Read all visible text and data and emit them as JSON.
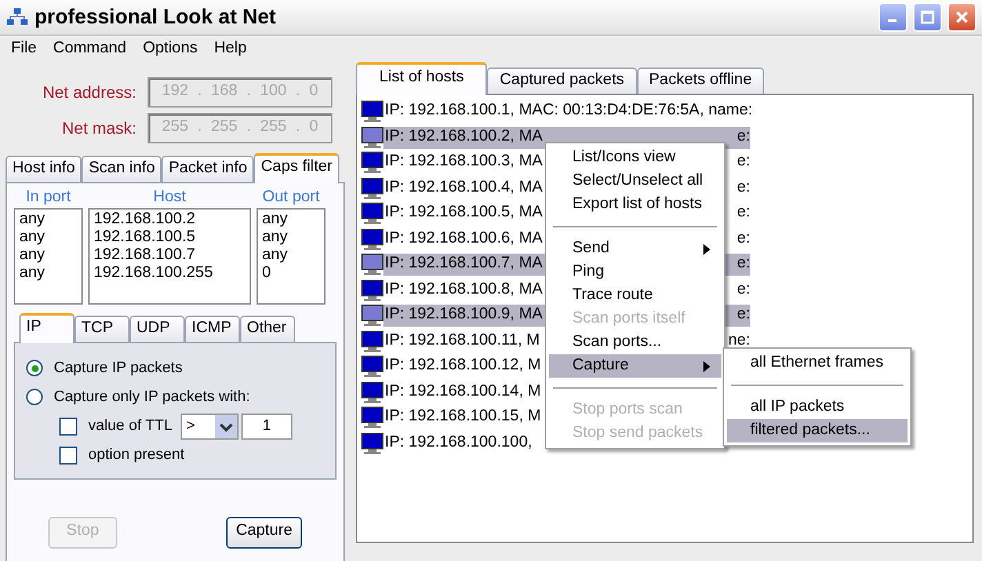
{
  "window": {
    "title": "professional Look at Net"
  },
  "menu_bar": [
    "File",
    "Command",
    "Options",
    "Help"
  ],
  "net": {
    "separator": ".",
    "address_label": "Net address:",
    "address": [
      "192",
      "168",
      "100",
      "0"
    ],
    "mask_label": "Net mask:",
    "mask": [
      "255",
      "255",
      "255",
      "0"
    ]
  },
  "left_tabs": [
    {
      "label": "Host info",
      "selected": false
    },
    {
      "label": "Scan info",
      "selected": false
    },
    {
      "label": "Packet info",
      "selected": false
    },
    {
      "label": "Caps filter",
      "selected": true
    }
  ],
  "filter": {
    "columns": [
      "In port",
      "Host",
      "Out port"
    ],
    "in_ports": [
      "any",
      "any",
      "any",
      "any"
    ],
    "hosts": [
      "192.168.100.2",
      "192.168.100.5",
      "192.168.100.7",
      "192.168.100.255"
    ],
    "out_ports": [
      "any",
      "any",
      "any",
      "0"
    ]
  },
  "protocol_tabs": [
    {
      "label": "IP",
      "selected": true
    },
    {
      "label": "TCP",
      "selected": false
    },
    {
      "label": "UDP",
      "selected": false
    },
    {
      "label": "ICMP",
      "selected": false
    },
    {
      "label": "Other",
      "selected": false
    }
  ],
  "ip_options": {
    "radios": [
      {
        "label": "Capture IP packets",
        "selected": true
      },
      {
        "label": "Capture only IP packets with:",
        "selected": false
      }
    ],
    "checks": [
      {
        "kind": "compare",
        "label": "value of TTL",
        "checked": false,
        "operator": ">",
        "value": "1"
      },
      {
        "kind": "plain",
        "label": "option present",
        "checked": false
      }
    ]
  },
  "buttons": [
    {
      "label": "Stop",
      "disabled": true
    },
    {
      "label": "Capture",
      "disabled": false
    }
  ],
  "right_tabs": [
    {
      "label": "List of hosts",
      "selected": true
    },
    {
      "label": "Captured packets",
      "selected": false
    },
    {
      "label": "Packets offline",
      "selected": false
    }
  ],
  "hosts": [
    {
      "text": "IP: 192.168.100.1, MAC: 00:13:D4:DE:76:5A, name:",
      "selected": false
    },
    {
      "text": "IP: 192.168.100.2, MA",
      "tail": "e:",
      "selected": true
    },
    {
      "text": "IP: 192.168.100.3, MA",
      "tail": "e:",
      "selected": false
    },
    {
      "text": "IP: 192.168.100.4, MA",
      "tail": "e:",
      "selected": false
    },
    {
      "text": "IP: 192.168.100.5, MA",
      "tail": "e:",
      "selected": false
    },
    {
      "text": "IP: 192.168.100.6, MA",
      "tail": "e:",
      "selected": false
    },
    {
      "text": "IP: 192.168.100.7, MA",
      "tail": "e:",
      "selected": true
    },
    {
      "text": "IP: 192.168.100.8, MA",
      "tail": "e:",
      "selected": false
    },
    {
      "text": "IP: 192.168.100.9, MA",
      "tail": "e:",
      "selected": true
    },
    {
      "text": "IP: 192.168.100.11, M",
      "tail": "ne:",
      "selected": false
    },
    {
      "text": "IP: 192.168.100.12, M",
      "selected": false
    },
    {
      "text": "IP: 192.168.100.14, M",
      "selected": false
    },
    {
      "text": "IP: 192.168.100.15, M",
      "selected": false
    },
    {
      "text": "IP: 192.168.100.100,",
      "selected": false
    }
  ],
  "context_menu": [
    {
      "kind": "item",
      "label": "List/Icons view",
      "disabled": false,
      "selected": false
    },
    {
      "kind": "item",
      "label": "Select/Unselect all",
      "disabled": false,
      "selected": false
    },
    {
      "kind": "item",
      "label": "Export list of hosts",
      "disabled": false,
      "selected": false
    },
    {
      "kind": "separator"
    },
    {
      "kind": "submenu",
      "label": "Send",
      "disabled": false,
      "selected": false
    },
    {
      "kind": "item",
      "label": "Ping",
      "disabled": false,
      "selected": false
    },
    {
      "kind": "item",
      "label": "Trace route",
      "disabled": false,
      "selected": false
    },
    {
      "kind": "item",
      "label": "Scan ports itself",
      "disabled": true,
      "selected": false
    },
    {
      "kind": "item",
      "label": "Scan ports...",
      "disabled": false,
      "selected": false
    },
    {
      "kind": "submenu",
      "label": "Capture",
      "disabled": false,
      "selected": true
    },
    {
      "kind": "separator"
    },
    {
      "kind": "item",
      "label": "Stop ports scan",
      "disabled": true,
      "selected": false
    },
    {
      "kind": "item",
      "label": "Stop send packets",
      "disabled": true,
      "selected": false
    }
  ],
  "submenu": [
    {
      "kind": "item",
      "label": "all Ethernet frames",
      "disabled": false,
      "selected": false
    },
    {
      "kind": "separator"
    },
    {
      "kind": "item",
      "label": "all IP packets",
      "disabled": false,
      "selected": false
    },
    {
      "kind": "item",
      "label": "filtered packets...",
      "disabled": false,
      "selected": true
    }
  ]
}
